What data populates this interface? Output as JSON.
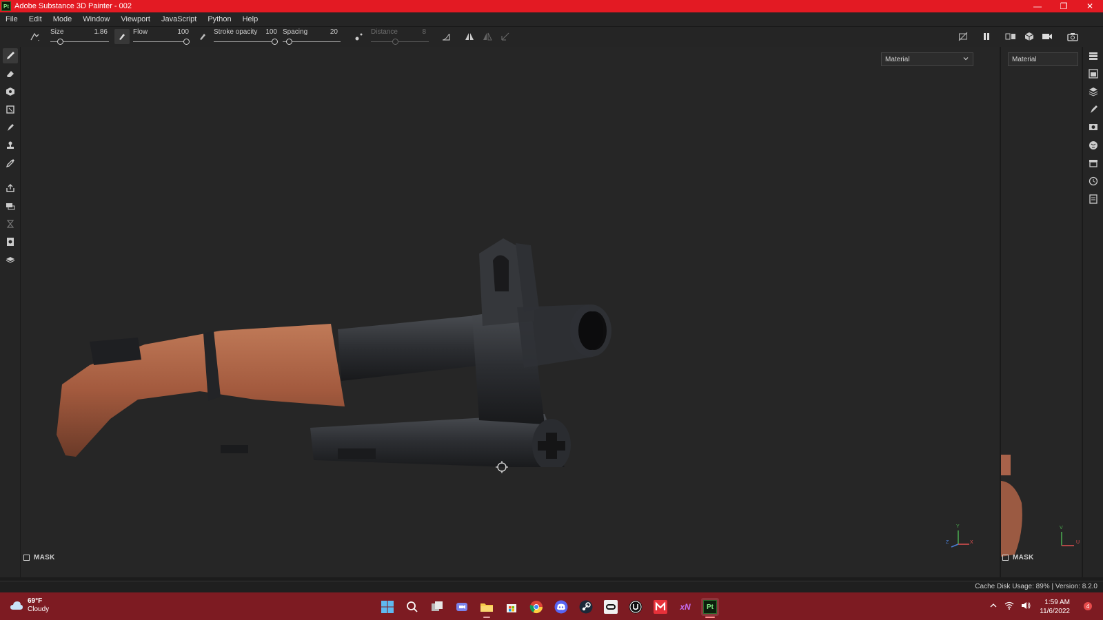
{
  "window": {
    "app_logo": "Pt",
    "title": "Adobe Substance 3D Painter - 002",
    "minimize_icon": "minimize-icon",
    "restore_icon": "restore-icon",
    "close_icon": "close-icon"
  },
  "menu": {
    "items": [
      "File",
      "Edit",
      "Mode",
      "Window",
      "Viewport",
      "JavaScript",
      "Python",
      "Help"
    ]
  },
  "toolbar": {
    "size_label": "Size",
    "size_value": "1.86",
    "flow_label": "Flow",
    "flow_value": "100",
    "stroke_opacity_label": "Stroke opacity",
    "stroke_opacity_value": "100",
    "spacing_label": "Spacing",
    "spacing_value": "20",
    "distance_label": "Distance",
    "distance_value": "8"
  },
  "viewport": {
    "channel_dropdown": "Material",
    "uv_channel_dropdown": "Material",
    "mask_label": "MASK",
    "mask_label_2d": "MASK",
    "axis_y": "Y",
    "axis_x": "X",
    "axis_z": "Z",
    "axis_v": "V",
    "axis_u": "U"
  },
  "status": {
    "text": "Cache Disk Usage:   89% | Version: 8.2.0"
  },
  "taskbar": {
    "temp": "69°F",
    "condition": "Cloudy",
    "time": "1:59 AM",
    "date": "11/6/2022",
    "xn_label": "xN",
    "pt_label": "Pt",
    "notification_count": "4"
  },
  "colors": {
    "titlebar": "#e31a23",
    "taskbar": "#7d1b22",
    "panel": "#252525",
    "viewport": "#262626"
  }
}
